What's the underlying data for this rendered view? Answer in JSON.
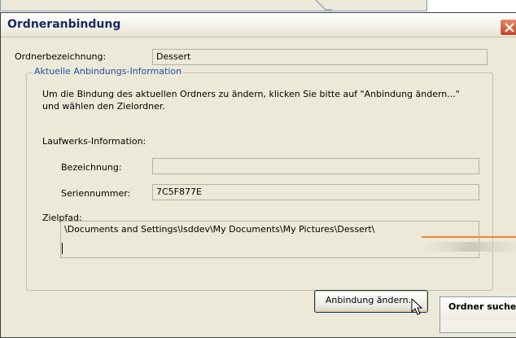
{
  "dialog": {
    "title": "Ordneranbindung",
    "folder_name_label": "Ordnerbezeichnung:",
    "folder_name_value": "Dessert",
    "group_title": "Aktuelle Anbindungs-Information",
    "instructions": "Um die Bindung des aktuellen Ordners zu ändern, klicken Sie bitte auf \"Anbindung ändern...\" und wählen den Zielordner.",
    "drive_info_label": "Laufwerks-Information:",
    "designation_label": "Bezeichnung:",
    "designation_value": "",
    "serial_label": "Seriennummer:",
    "serial_value": "7C5F877E",
    "target_path_label": "Zielpfad:",
    "target_path_value": "\\Documents and Settings\\lsddev\\My Documents\\My Pictures\\Dessert\\",
    "change_button_label": "Anbindung ändern..."
  },
  "folder_dialog": {
    "title": "Ordner suchen"
  },
  "colors": {
    "accent_orange": "#f0843c",
    "legend_blue": "#1f4ea3",
    "close_red": "#c9401f"
  }
}
